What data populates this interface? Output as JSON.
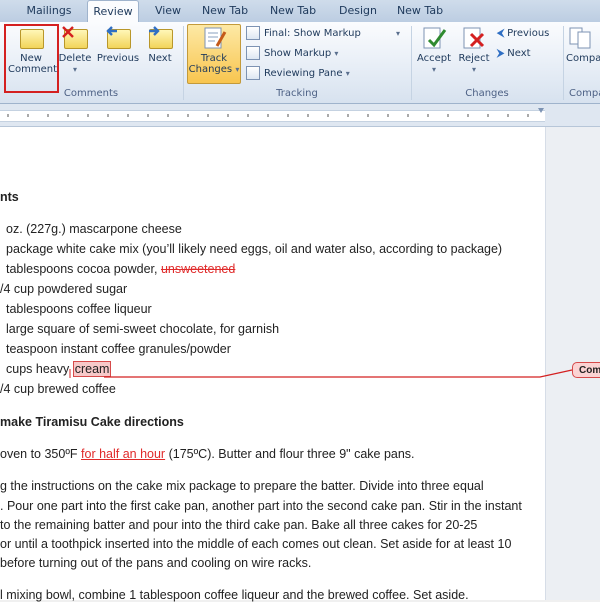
{
  "tabs": [
    "Mailings",
    "Review",
    "View",
    "New Tab",
    "New Tab",
    "Design",
    "New Tab"
  ],
  "ribbon": {
    "new_comment": [
      "New",
      "Comment"
    ],
    "delete": "Delete",
    "previous": "Previous",
    "next": "Next",
    "comments_group": "Comments",
    "track_changes": [
      "Track",
      "Changes"
    ],
    "display_for_review": "Final: Show Markup",
    "show_markup": "Show Markup",
    "reviewing_pane": "Reviewing Pane",
    "tracking_group": "Tracking",
    "accept": "Accept",
    "reject": "Reject",
    "prev_change": "Previous",
    "next_change": "Next",
    "changes_group": "Changes",
    "compare": "Compa",
    "compare_group": "Compa"
  },
  "document": {
    "heading_ingredients": "nts",
    "items": {
      "i1": "oz. (227g.) mascarpone cheese",
      "i2": "package white cake mix (you’ll likely need eggs, oil and water also, according to package)",
      "i3_a": "tablespoons cocoa powder, ",
      "i3_del": "unsweetened",
      "i4": "/4 cup powdered sugar",
      "i5": "tablespoons coffee liqueur",
      "i6": "large square of semi-sweet chocolate, for garnish",
      "i7": "teaspoon instant coffee granules/powder",
      "i8_a": "cups heavy ",
      "i8_cmt": "cream",
      "i9": "/4 cup brewed coffee"
    },
    "heading_directions": "make Tiramisu Cake directions",
    "p1_a": "oven to 350ºF ",
    "p1_ins": "for half an hour",
    "p1_b": " (175ºC). Butter and flour three 9\" cake pans.",
    "p2": [
      "g the instructions on the cake mix package to prepare the batter. Divide into three equal",
      ". Pour one part into the first cake pan, another part into the second cake pan. Stir in the instant",
      "to the remaining batter and pour into the third cake pan. Bake all three cakes for 20-25",
      "or until a toothpick inserted into the middle of each comes out clean. Set aside for at least 10",
      "before turning out of the pans and cooling on wire racks."
    ],
    "p3": "l mixing bowl, combine 1 tablespoon coffee liqueur and the brewed coffee. Set aside."
  },
  "comment_balloon": "Com",
  "colors": {
    "markup_red": "#e02a2a",
    "highlight_box": "#d42020"
  }
}
